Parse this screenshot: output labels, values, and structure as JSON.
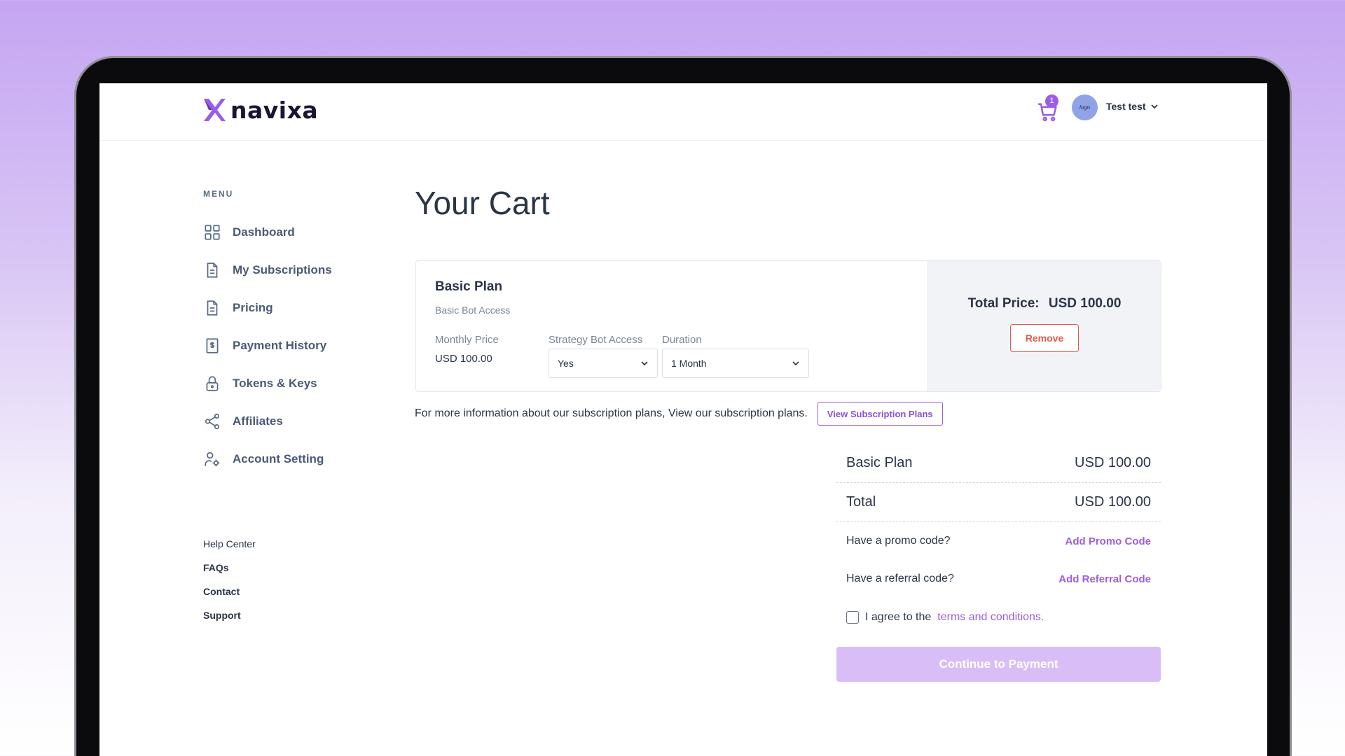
{
  "brand": {
    "name": "navixa",
    "accent": "#9b5de5"
  },
  "header": {
    "cart_count": "1",
    "user_name": "Test test",
    "avatar_text": "logo"
  },
  "sidebar": {
    "menu_label": "MENU",
    "items": [
      {
        "label": "Dashboard",
        "icon": "grid-icon"
      },
      {
        "label": "My Subscriptions",
        "icon": "document-icon"
      },
      {
        "label": "Pricing",
        "icon": "document-icon"
      },
      {
        "label": "Payment History",
        "icon": "receipt-icon"
      },
      {
        "label": "Tokens & Keys",
        "icon": "lock-icon"
      },
      {
        "label": "Affiliates",
        "icon": "share-icon"
      },
      {
        "label": "Account Setting",
        "icon": "user-settings-icon"
      }
    ],
    "footer": [
      "Help Center",
      "FAQs",
      "Contact",
      "Support"
    ]
  },
  "main": {
    "title": "Your Cart",
    "card": {
      "plan_name": "Basic Plan",
      "plan_desc": "Basic Bot Access",
      "monthly_price_label": "Monthly Price",
      "monthly_price_value": "USD 100.00",
      "strategy_label": "Strategy Bot Access",
      "strategy_value": "Yes",
      "duration_label": "Duration",
      "duration_value": "1 Month",
      "total_label": "Total Price:",
      "total_value": "USD 100.00",
      "remove_label": "Remove"
    },
    "info_text": "For more information about our subscription plans, View our subscription plans.",
    "view_plans_label": "View Subscription Plans",
    "summary": {
      "plan_label": "Basic Plan",
      "plan_value": "USD 100.00",
      "total_label": "Total",
      "total_value": "USD 100.00",
      "promo_question": "Have a promo code?",
      "promo_link": "Add Promo Code",
      "referral_question": "Have a referral code?",
      "referral_link": "Add Referral Code",
      "agree_text": "I agree to the",
      "terms_link": "terms and conditions.",
      "pay_label": "Continue to Payment"
    }
  }
}
